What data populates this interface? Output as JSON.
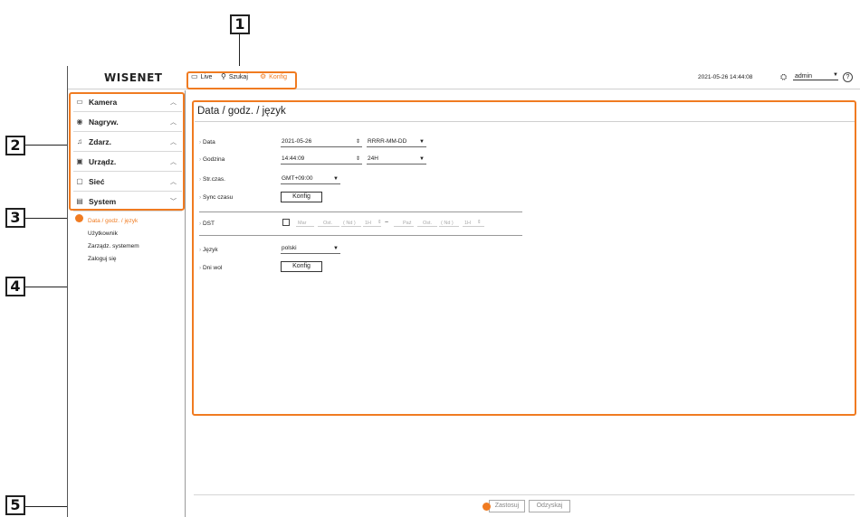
{
  "callouts": [
    "1",
    "2",
    "3",
    "4",
    "5"
  ],
  "app": {
    "brand": "WISENET",
    "nav": [
      {
        "label": "Live",
        "icon": "monitor-icon"
      },
      {
        "label": "Szukaj",
        "icon": "search-icon"
      },
      {
        "label": "Konfig",
        "icon": "gear-icon",
        "active": true
      }
    ],
    "datetime": "2021-05-26 14:44:08",
    "user": "admin"
  },
  "sidebar": {
    "menu": [
      {
        "label": "Kamera",
        "icon": "camera-icon"
      },
      {
        "label": "Nagryw.",
        "icon": "record-icon"
      },
      {
        "label": "Zdarz.",
        "icon": "bell-icon"
      },
      {
        "label": "Urządz.",
        "icon": "device-icon"
      },
      {
        "label": "Sieć",
        "icon": "network-icon"
      },
      {
        "label": "System",
        "icon": "system-icon"
      }
    ],
    "submenu": [
      "Data / godz. / język",
      "Użytkownik",
      "Zarządz. systemem",
      "Zaloguj się"
    ]
  },
  "main": {
    "title": "Data / godz. / język",
    "data_label": "Data",
    "date_value": "2021-05-26",
    "date_format": "RRRR-MM-DD",
    "time_label": "Godzina",
    "time_value": "14:44:09",
    "time_format": "24H",
    "tz_label": "Str.czas.",
    "tz_value": "GMT+09:00",
    "sync_label": "Sync czasu",
    "sync_button": "Konfig",
    "dst_label": "DST",
    "dst": {
      "start_month": "Mar",
      "start_week": "Ost.",
      "start_day": "( Nd )",
      "start_hour": "1H",
      "end_month": "Paź",
      "end_week": "Ost.",
      "end_day": "( Nd )",
      "end_hour": "1H",
      "separator": "~"
    },
    "lang_label": "Język",
    "lang_value": "polski",
    "holidays_label": "Dni wol",
    "holidays_button": "Konfig"
  },
  "footer": {
    "apply": "Zastosuj",
    "cancel": "Odzyskaj"
  },
  "colors": {
    "accent": "#f07b21"
  }
}
